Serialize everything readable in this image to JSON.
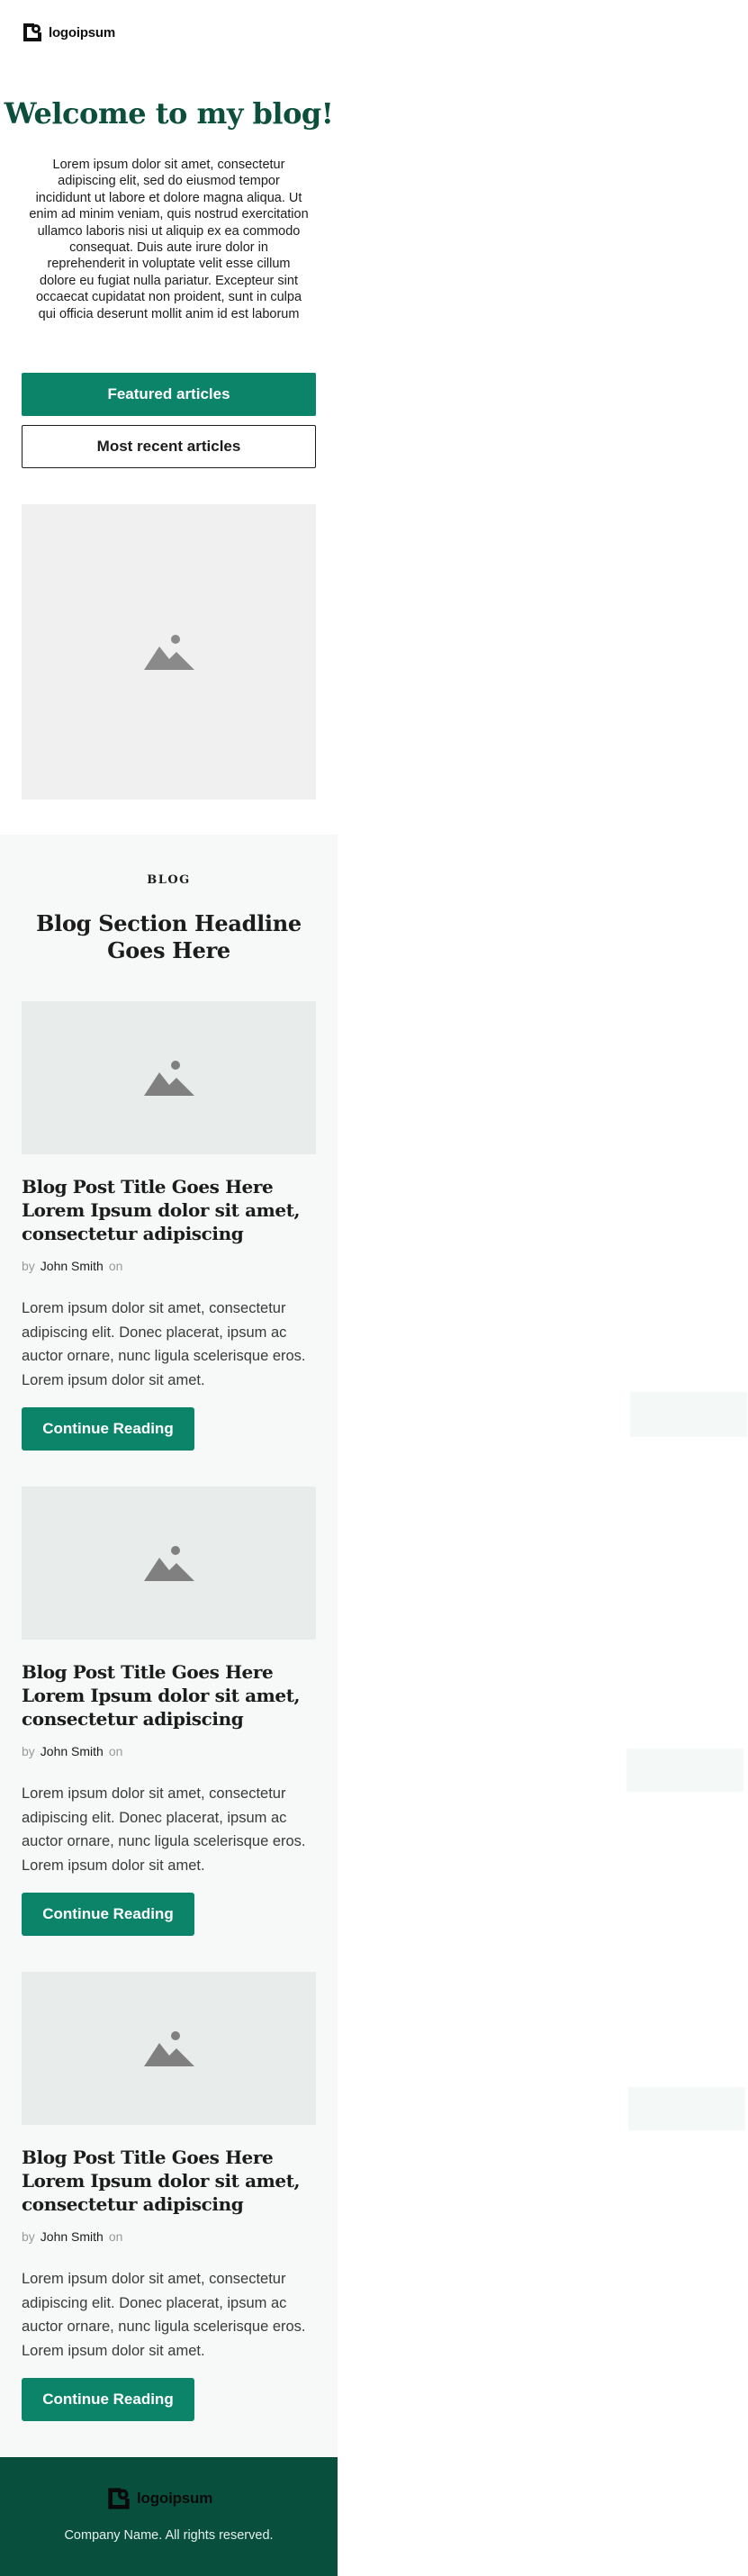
{
  "header": {
    "logo_text": "logoipsum"
  },
  "hero": {
    "title": "Welcome to my blog!",
    "text": "Lorem ipsum dolor sit amet, consectetur adipiscing elit, sed do eiusmod tempor incididunt ut labore et dolore magna aliqua. Ut enim ad minim veniam, quis nostrud exercitation ullamco laboris nisi ut aliquip ex ea commodo consequat. Duis aute irure dolor in reprehenderit in voluptate velit esse cillum dolore eu fugiat nulla pariatur. Excepteur sint occaecat cupidatat non proident, sunt in culpa qui officia deserunt mollit anim id est laborum"
  },
  "buttons": {
    "featured_label": "Featured articles",
    "recent_label": "Most recent articles"
  },
  "blog": {
    "eyebrow": "BLOG",
    "headline": "Blog Section Headline Goes Here",
    "posts": [
      {
        "title": "Blog Post Title Goes Here Lorem Ipsum dolor sit amet, consectetur adipiscing",
        "by": "by",
        "author": "John Smith",
        "on": "on",
        "excerpt": "Lorem ipsum dolor sit amet, consectetur adipiscing elit. Donec placerat, ipsum ac auctor ornare, nunc ligula scelerisque eros. Lorem ipsum dolor sit amet.",
        "cta": "Continue Reading"
      },
      {
        "title": "Blog Post Title Goes Here Lorem Ipsum dolor sit amet, consectetur adipiscing",
        "by": "by",
        "author": "John Smith",
        "on": "on",
        "excerpt": "Lorem ipsum dolor sit amet, consectetur adipiscing elit. Donec placerat, ipsum ac auctor ornare, nunc ligula scelerisque eros. Lorem ipsum dolor sit amet.",
        "cta": "Continue Reading"
      },
      {
        "title": "Blog Post Title Goes Here Lorem Ipsum dolor sit amet, consectetur adipiscing",
        "by": "by",
        "author": "John Smith",
        "on": "on",
        "excerpt": "Lorem ipsum dolor sit amet, consectetur adipiscing elit. Donec placerat, ipsum ac auctor ornare, nunc ligula scelerisque eros. Lorem ipsum dolor sit amet.",
        "cta": "Continue Reading"
      }
    ]
  },
  "footer": {
    "logo_text": "logoipsum",
    "copyright": "Company Name. All rights reserved."
  },
  "colors": {
    "brand_green": "#0b8469",
    "dark_green": "#0c4f3c",
    "footer_bg": "#08503d",
    "placeholder_bg": "#f0f0f0",
    "section_bg": "#f6f9f8"
  },
  "icons": {
    "logo": "logo-mark-icon",
    "image": "image-placeholder-icon"
  }
}
